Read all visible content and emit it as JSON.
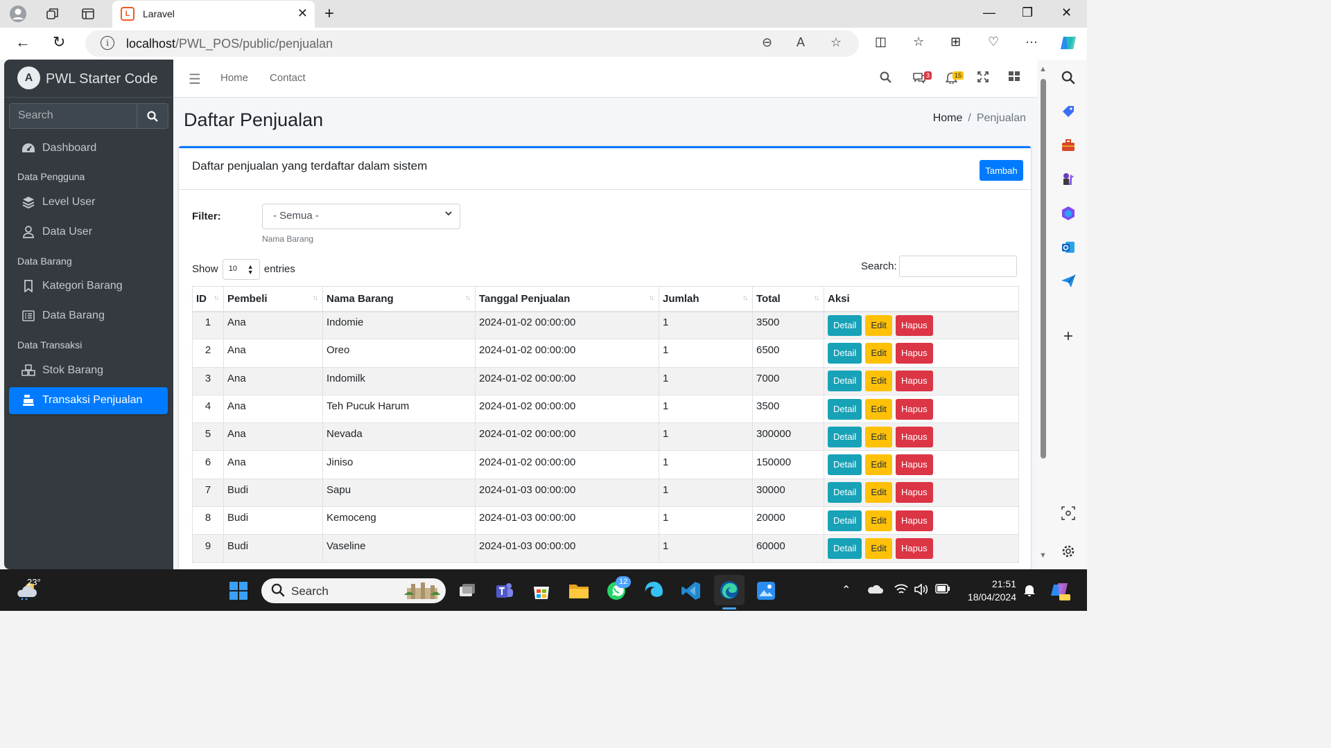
{
  "browser": {
    "tab_title": "Laravel",
    "url_host": "localhost",
    "url_path": "/PWL_POS/public/penjualan"
  },
  "sidebar": {
    "brand": "PWL Starter Code",
    "search_placeholder": "Search",
    "items": [
      {
        "label": "Dashboard",
        "icon": "dashboard-icon"
      },
      {
        "header": "Data Pengguna"
      },
      {
        "label": "Level User",
        "icon": "layers-icon"
      },
      {
        "label": "Data User",
        "icon": "user-icon"
      },
      {
        "header": "Data Barang"
      },
      {
        "label": "Kategori Barang",
        "icon": "bookmark-icon"
      },
      {
        "label": "Data Barang",
        "icon": "list-icon"
      },
      {
        "header": "Data Transaksi"
      },
      {
        "label": "Stok Barang",
        "icon": "cubes-icon"
      },
      {
        "label": "Transaksi Penjualan",
        "icon": "cash-register-icon",
        "active": true
      }
    ]
  },
  "topnav": {
    "home": "Home",
    "contact": "Contact",
    "messages_count": "3",
    "notifications_count": "15"
  },
  "page": {
    "title": "Daftar Penjualan",
    "breadcrumb_home": "Home",
    "breadcrumb_current": "Penjualan"
  },
  "card": {
    "title": "Daftar penjualan yang terdaftar dalam sistem",
    "add_button": "Tambah",
    "filter_label": "Filter:",
    "filter_value": "- Semua -",
    "filter_help": "Nama Barang",
    "show_label": "Show",
    "entries_value": "10",
    "entries_label": "entries",
    "search_label": "Search:"
  },
  "table": {
    "columns": [
      "ID",
      "Pembeli",
      "Nama Barang",
      "Tanggal Penjualan",
      "Jumlah",
      "Total",
      "Aksi"
    ],
    "actions": {
      "detail": "Detail",
      "edit": "Edit",
      "delete": "Hapus"
    },
    "rows": [
      {
        "id": "1",
        "pembeli": "Ana",
        "barang": "Indomie",
        "tanggal": "2024-01-02 00:00:00",
        "jumlah": "1",
        "total": "3500"
      },
      {
        "id": "2",
        "pembeli": "Ana",
        "barang": "Oreo",
        "tanggal": "2024-01-02 00:00:00",
        "jumlah": "1",
        "total": "6500"
      },
      {
        "id": "3",
        "pembeli": "Ana",
        "barang": "Indomilk",
        "tanggal": "2024-01-02 00:00:00",
        "jumlah": "1",
        "total": "7000"
      },
      {
        "id": "4",
        "pembeli": "Ana",
        "barang": "Teh Pucuk Harum",
        "tanggal": "2024-01-02 00:00:00",
        "jumlah": "1",
        "total": "3500"
      },
      {
        "id": "5",
        "pembeli": "Ana",
        "barang": "Nevada",
        "tanggal": "2024-01-02 00:00:00",
        "jumlah": "1",
        "total": "300000"
      },
      {
        "id": "6",
        "pembeli": "Ana",
        "barang": "Jiniso",
        "tanggal": "2024-01-02 00:00:00",
        "jumlah": "1",
        "total": "150000"
      },
      {
        "id": "7",
        "pembeli": "Budi",
        "barang": "Sapu",
        "tanggal": "2024-01-03 00:00:00",
        "jumlah": "1",
        "total": "30000"
      },
      {
        "id": "8",
        "pembeli": "Budi",
        "barang": "Kemoceng",
        "tanggal": "2024-01-03 00:00:00",
        "jumlah": "1",
        "total": "20000"
      },
      {
        "id": "9",
        "pembeli": "Budi",
        "barang": "Vaseline",
        "tanggal": "2024-01-03 00:00:00",
        "jumlah": "1",
        "total": "60000"
      }
    ]
  },
  "taskbar": {
    "weather": "23°",
    "search": "Search",
    "whatsapp_badge": "12",
    "time": "21:51",
    "date": "18/04/2024"
  },
  "colors": {
    "primary": "#007bff",
    "sidebar_bg": "#343a40",
    "info": "#17a2b8",
    "warning": "#ffc107",
    "danger": "#dc3545"
  }
}
